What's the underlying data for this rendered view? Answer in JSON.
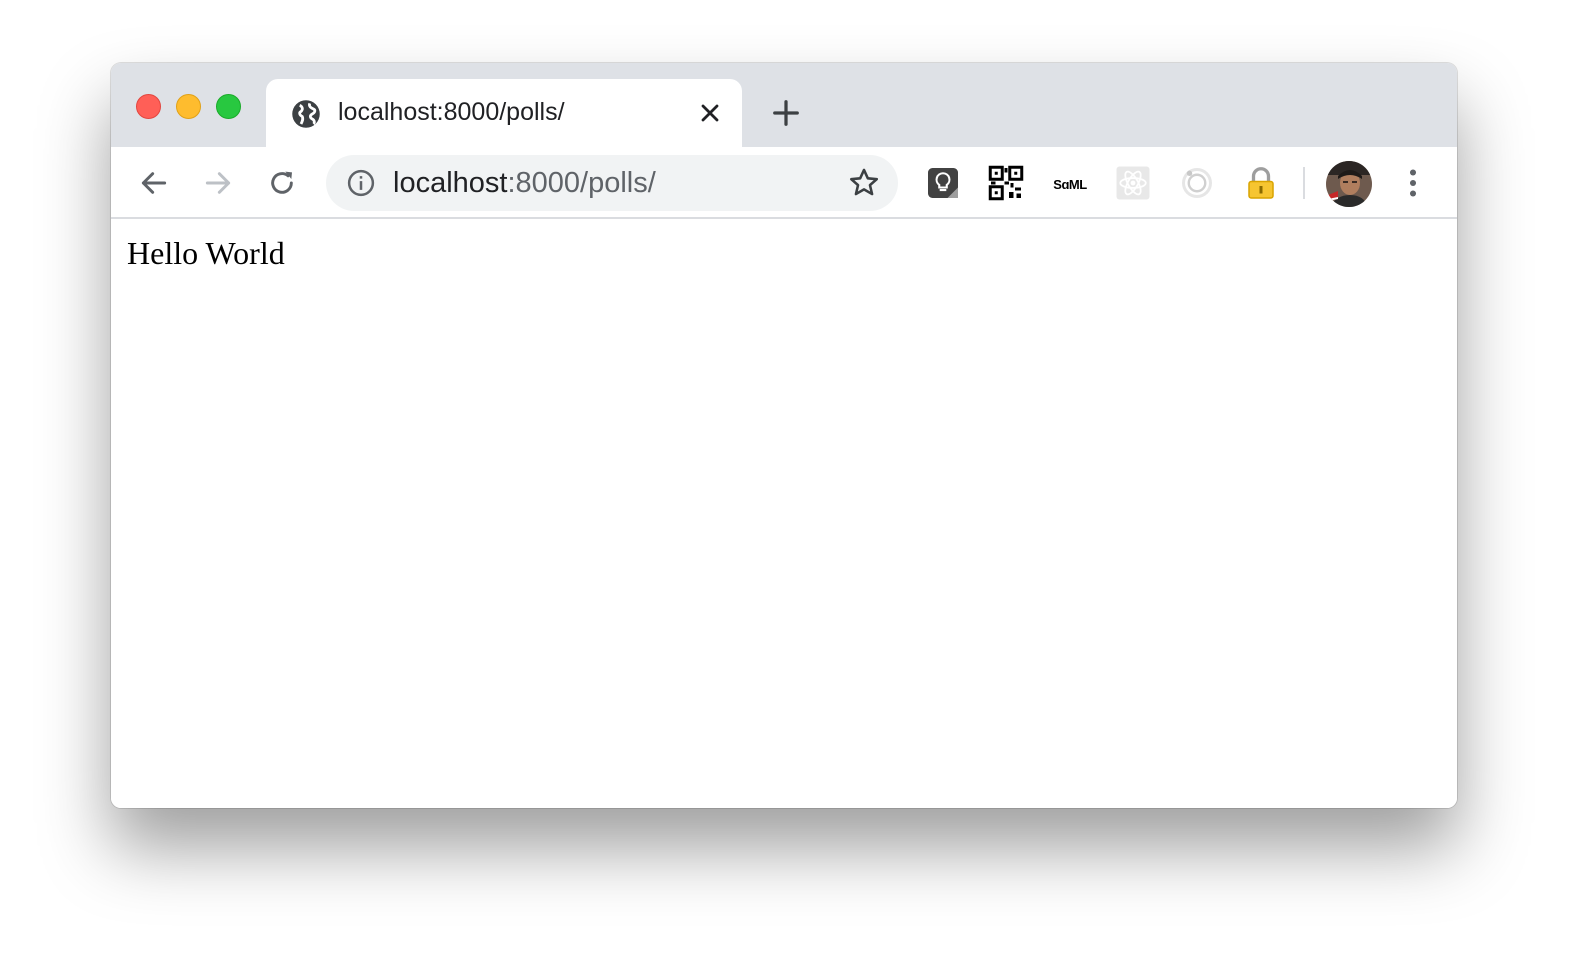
{
  "browser": {
    "tab": {
      "title": "localhost:8000/polls/",
      "favicon": "globe-icon"
    },
    "address_bar": {
      "host": "localhost",
      "path": ":8000/polls/"
    },
    "extensions": [
      "lightbulb-extension-icon",
      "qr-code-extension-icon",
      "saml-extension-icon",
      "react-extension-icon",
      "ring-extension-icon",
      "lock-extension-icon"
    ],
    "colors": {
      "tabstrip": "#dee1e6",
      "omnibox": "#f1f3f4",
      "traffic_close": "#ff5f57",
      "traffic_minimize": "#febc2e",
      "traffic_maximize": "#28c840"
    }
  },
  "page": {
    "body_text": "Hello World"
  }
}
